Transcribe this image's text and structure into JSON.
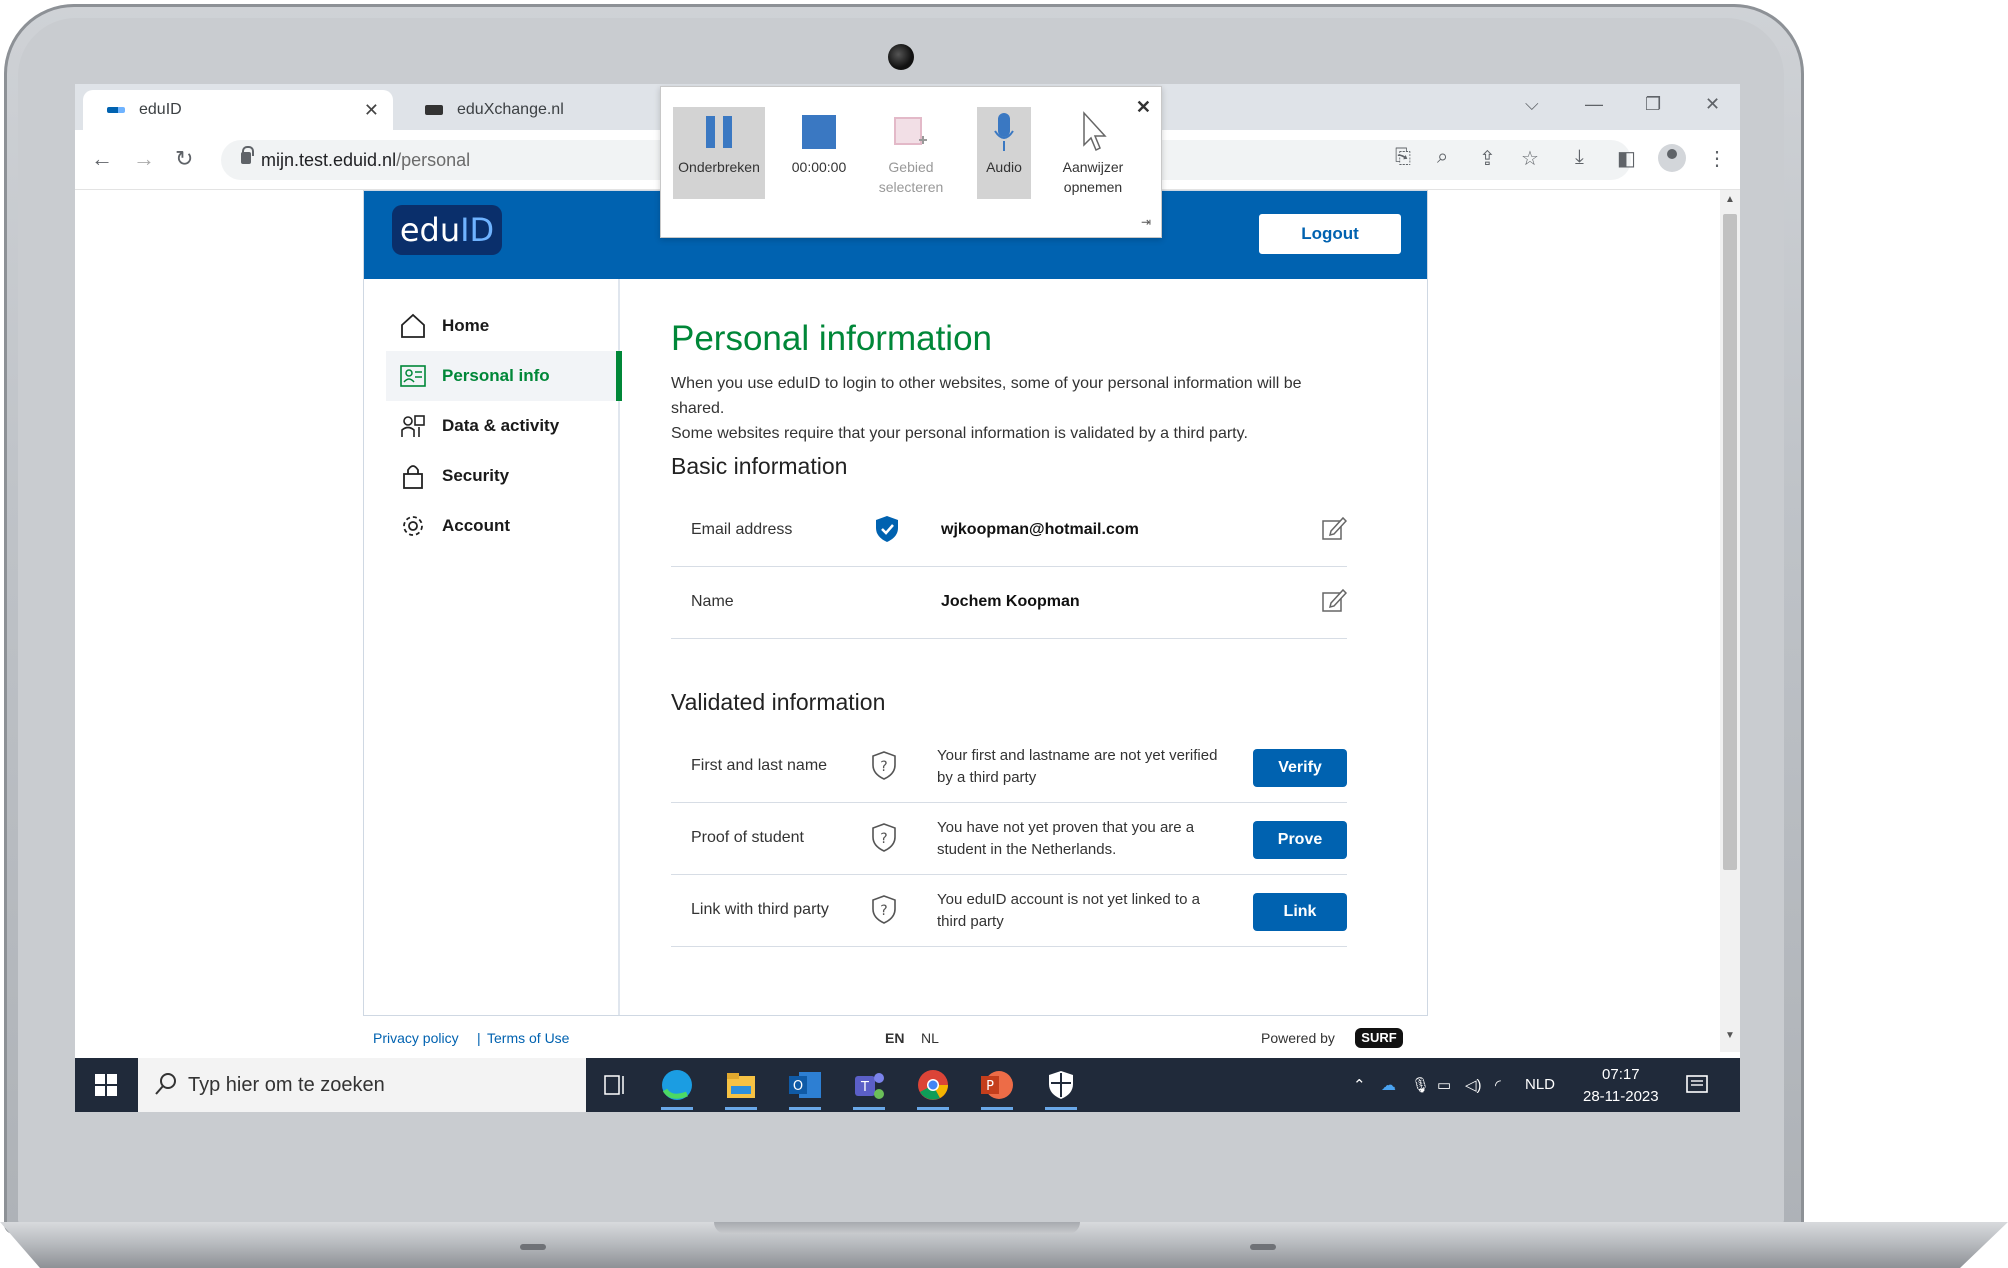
{
  "browser": {
    "tabs": [
      {
        "label": "eduID",
        "active": true
      },
      {
        "label": "eduXchange.nl",
        "active": false
      }
    ],
    "url_host": "mijn.test.eduid.nl",
    "url_path": "/personal"
  },
  "recorder": {
    "buttons": [
      {
        "label": "Onderbreken",
        "icon": "pause-icon"
      },
      {
        "label": "00:00:00",
        "icon": "stop-icon"
      },
      {
        "label": "Gebied selecteren",
        "icon": "select-area-icon"
      },
      {
        "label": "Audio",
        "icon": "microphone-icon"
      },
      {
        "label": "Aanwijzer opnemen",
        "icon": "pointer-icon"
      }
    ]
  },
  "header": {
    "logo_prefix": "edu",
    "logo_suffix": "ID",
    "logout_label": "Logout",
    "brand_color": "#0062b0"
  },
  "sidebar": {
    "items": [
      {
        "label": "Home",
        "icon": "home-icon"
      },
      {
        "label": "Personal info",
        "icon": "personal-info-icon",
        "active": true
      },
      {
        "label": "Data & activity",
        "icon": "data-activity-icon"
      },
      {
        "label": "Security",
        "icon": "lock-icon"
      },
      {
        "label": "Account",
        "icon": "gear-icon"
      }
    ]
  },
  "main": {
    "title": "Personal information",
    "intro_line1": "When you use eduID to login to other websites, some of your personal information will be shared.",
    "intro_line2": "Some websites require that your personal information is validated by a third party.",
    "basic_heading": "Basic information",
    "basic_rows": [
      {
        "label": "Email address",
        "value": "wjkoopman@hotmail.com"
      },
      {
        "label": "Name",
        "value": "Jochem Koopman"
      }
    ],
    "validated_heading": "Validated information",
    "validated_rows": [
      {
        "label": "First and last name",
        "desc": "Your first and lastname are not yet verified by a third party",
        "button": "Verify"
      },
      {
        "label": "Proof of student",
        "desc": "You have not yet proven that you are a student in the Netherlands.",
        "button": "Prove"
      },
      {
        "label": "Link with third party",
        "desc": "You eduID account is not yet linked to a third party",
        "button": "Link"
      }
    ]
  },
  "footer": {
    "privacy": "Privacy policy",
    "separator": "|",
    "terms": "Terms of Use",
    "lang_en": "EN",
    "lang_nl": "NL",
    "powered_by": "Powered by",
    "surf": "SURF"
  },
  "taskbar": {
    "search_placeholder": "Typ hier om te zoeken",
    "language": "NLD",
    "time": "07:17",
    "date": "28-11-2023"
  }
}
